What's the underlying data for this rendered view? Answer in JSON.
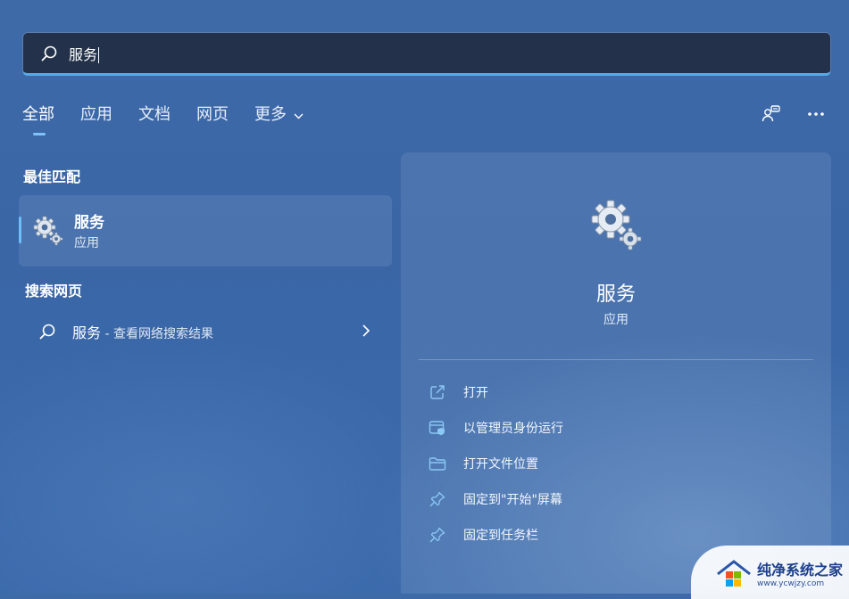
{
  "search": {
    "value": "服务"
  },
  "tabs": [
    {
      "label": "全部",
      "active": true
    },
    {
      "label": "应用"
    },
    {
      "label": "文档"
    },
    {
      "label": "网页"
    },
    {
      "label": "更多"
    }
  ],
  "top_right": {
    "icons": [
      "account-switch-icon",
      "more-options-icon"
    ]
  },
  "best_match": {
    "title": "最佳匹配",
    "item": {
      "name": "服务",
      "type": "应用",
      "icon": "gear-icon"
    }
  },
  "web_search": {
    "title": "搜索网页",
    "item": {
      "query": "服务",
      "hint": " - 查看网络搜索结果"
    }
  },
  "details": {
    "name": "服务",
    "type": "应用",
    "actions": [
      {
        "label": "打开",
        "icon": "open-external-icon"
      },
      {
        "label": "以管理员身份运行",
        "icon": "admin-shield-icon"
      },
      {
        "label": "打开文件位置",
        "icon": "folder-icon"
      },
      {
        "label": "固定到\"开始\"屏幕",
        "icon": "pin-icon"
      },
      {
        "label": "固定到任务栏",
        "icon": "pin-icon"
      }
    ]
  },
  "watermark": {
    "title": "纯净系统之家",
    "url": "www.ycwjzy.com"
  },
  "colors": {
    "accent": "#6fbdf7",
    "search_bg": "#23324a",
    "background": "#3b69a9"
  }
}
